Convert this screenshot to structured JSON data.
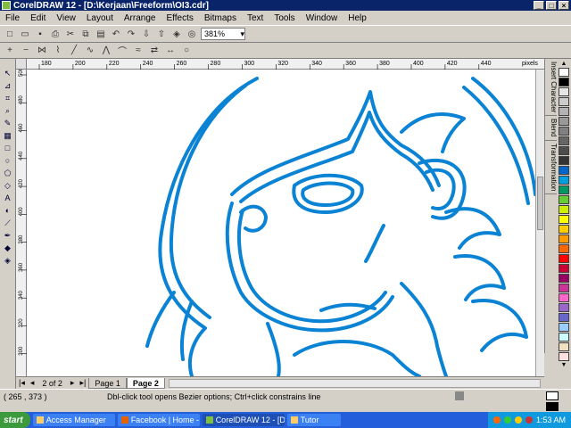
{
  "window": {
    "title": "CorelDRAW 12 - [D:\\Kerjaan\\Freeform\\OI3.cdr]"
  },
  "menu": [
    "File",
    "Edit",
    "View",
    "Layout",
    "Arrange",
    "Effects",
    "Bitmaps",
    "Text",
    "Tools",
    "Window",
    "Help"
  ],
  "toolbar": {
    "zoom_value": "381%"
  },
  "ruler": {
    "h_ticks": [
      "180",
      "200",
      "220",
      "240",
      "260",
      "280",
      "300",
      "320",
      "340",
      "360",
      "380",
      "400",
      "420",
      "440"
    ],
    "h_unit": "pixels",
    "v_ticks": [
      "500",
      "480",
      "460",
      "440",
      "420",
      "400",
      "380",
      "360",
      "340",
      "320",
      "300"
    ]
  },
  "pages": {
    "count_label": "2 of 2",
    "tabs": [
      "Page 1",
      "Page 2"
    ],
    "active": "Page 2"
  },
  "dockers": [
    "Insert Character",
    "Blend",
    "Transformation"
  ],
  "status": {
    "coords": "( 265 , 373 )",
    "hint": "Dbl-click tool opens Bezier options; Ctrl+click constrains line"
  },
  "palette": [
    "#ffffff",
    "#000000",
    "#e6e6e6",
    "#cccccc",
    "#b3b3b3",
    "#999999",
    "#808080",
    "#666666",
    "#4d4d4d",
    "#333333",
    "#0066cc",
    "#00a0e0",
    "#009966",
    "#66cc33",
    "#ccee00",
    "#ffff00",
    "#ffcc00",
    "#ff9900",
    "#ff6600",
    "#ff0000",
    "#cc0033",
    "#990066",
    "#cc3399",
    "#ff66cc",
    "#9966cc",
    "#6666cc",
    "#99ccff",
    "#ccffff",
    "#f0e0c0",
    "#ffe0e0"
  ],
  "taskbar": {
    "start": "start",
    "tasks": [
      "Access Manager",
      "Facebook | Home - Mozill...",
      "CorelDRAW 12 - [D:\\K...",
      "Tutor"
    ],
    "active_task": "CorelDRAW 12 - [D:\\K...",
    "time": "1:53 AM"
  },
  "drawing": {
    "stroke_color": "#0a83d4"
  }
}
